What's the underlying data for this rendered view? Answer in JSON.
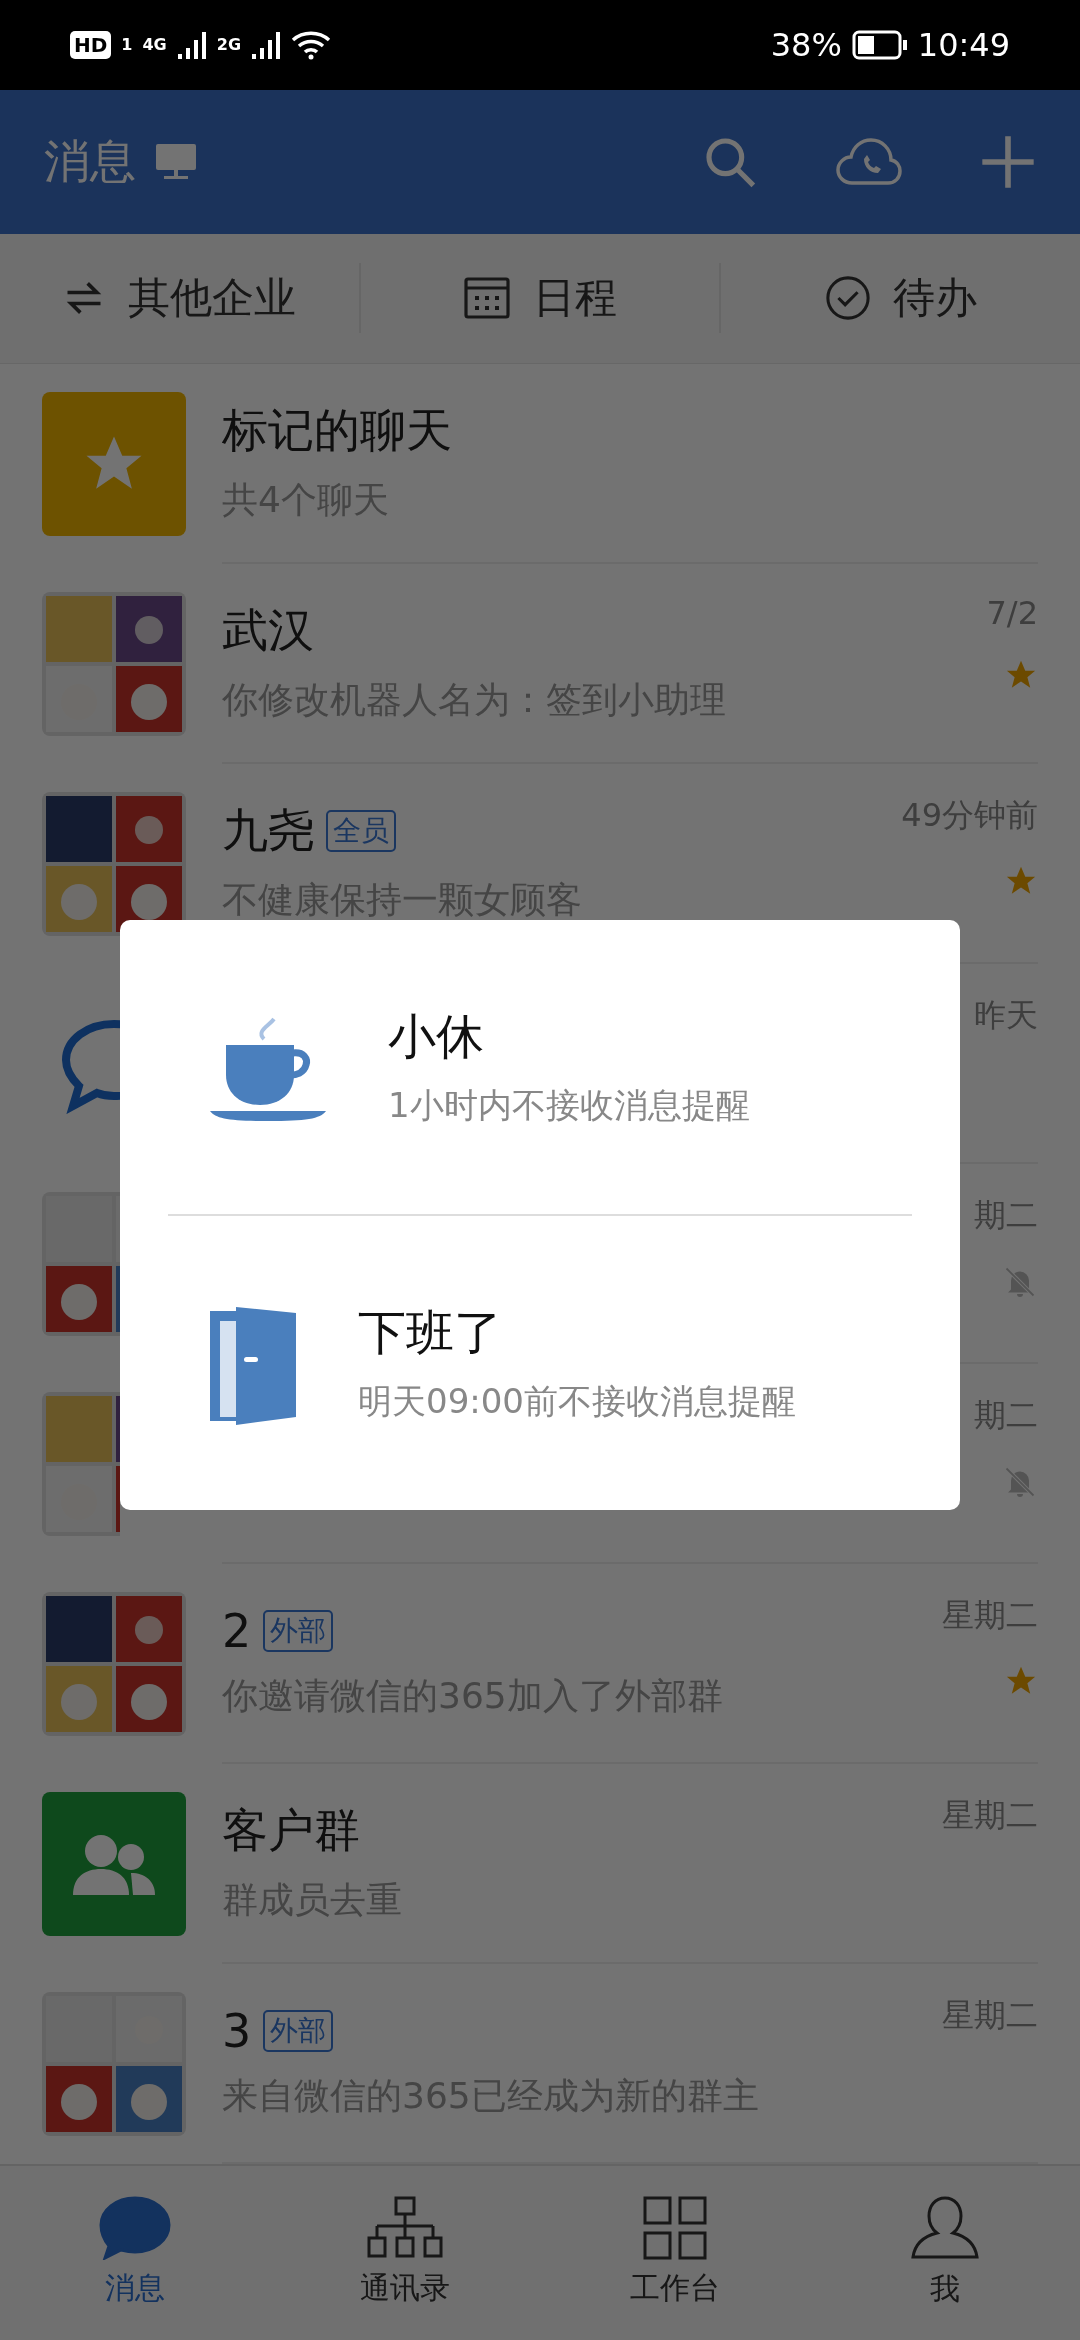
{
  "status_bar": {
    "badges": [
      "HD",
      "1"
    ],
    "networks": [
      "4G",
      "2G"
    ],
    "battery": "38%",
    "time": "10:49"
  },
  "app_bar": {
    "title": "消息"
  },
  "shortcuts": [
    {
      "kind": "switch",
      "label": "其他企业"
    },
    {
      "kind": "calendar",
      "label": "日程"
    },
    {
      "kind": "todo",
      "label": "待办"
    }
  ],
  "chats": [
    {
      "kind": "star",
      "title": "标记的聊天",
      "preview": "共4个聊天",
      "starred": false,
      "muted": false
    },
    {
      "kind": "picture",
      "title": "武汉",
      "preview": "你修改机器人名为：签到小助理",
      "time": "7/2",
      "starred": true,
      "muted": false
    },
    {
      "kind": "picture",
      "title": "九尧",
      "tag": "全员",
      "preview": "不健康保持一颗女顾客",
      "time": "49分钟前",
      "starred": true,
      "muted": false
    },
    {
      "kind": "chat",
      "time": "昨天",
      "starred": false,
      "muted": false
    },
    {
      "kind": "picture",
      "time": "期二",
      "starred": false,
      "muted": true
    },
    {
      "kind": "picture",
      "time": "期二",
      "starred": false,
      "muted": true
    },
    {
      "kind": "picture",
      "title": "2",
      "tag": "外部",
      "preview": "你邀请微信的365加入了外部群",
      "time": "星期二",
      "starred": true,
      "muted": false
    },
    {
      "kind": "group",
      "title": "客户群",
      "preview": "群成员去重",
      "time": "星期二",
      "starred": false,
      "muted": false
    },
    {
      "kind": "picture",
      "title": "3",
      "tag": "外部",
      "preview": "来自微信的365已经成为新的群主",
      "time": "星期二",
      "starred": false,
      "muted": false
    }
  ],
  "dialog": {
    "options": [
      {
        "kind": "cup",
        "title": "小休",
        "subtitle": "1小时内不接收消息提醒"
      },
      {
        "kind": "door",
        "title": "下班了",
        "subtitle": "明天09:00前不接收消息提醒"
      }
    ]
  },
  "nav": [
    {
      "kind": "chat",
      "label": "消息",
      "selected": true
    },
    {
      "kind": "org",
      "label": "通讯录",
      "selected": false
    },
    {
      "kind": "grid",
      "label": "工作台",
      "selected": false
    },
    {
      "kind": "person",
      "label": "我",
      "selected": false
    }
  ]
}
